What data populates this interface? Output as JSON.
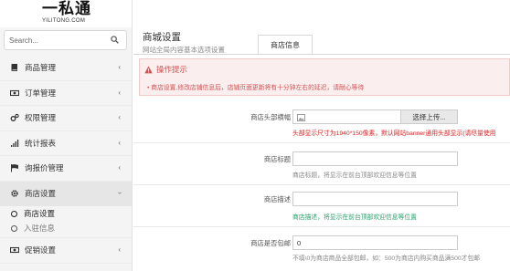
{
  "brand": {
    "name_cn": "一私通",
    "name_en": "YILITONG.COM"
  },
  "search": {
    "placeholder": "Search..."
  },
  "sidebar": {
    "items": [
      {
        "label": "商品管理",
        "icon": "book-icon"
      },
      {
        "label": "订单管理",
        "icon": "money-icon"
      },
      {
        "label": "权限管理",
        "icon": "cogs-icon"
      },
      {
        "label": "统计报表",
        "icon": "bar-chart-icon"
      },
      {
        "label": "询报价管理",
        "icon": "flag-icon"
      },
      {
        "label": "商店设置",
        "icon": "gear-icon"
      }
    ],
    "submenu": [
      {
        "label": "商店设置",
        "active": true
      },
      {
        "label": "入驻信息",
        "active": false
      }
    ],
    "after": {
      "label": "促销设置",
      "icon": "money-icon"
    }
  },
  "header": {
    "title": "商城设置",
    "subtitle": "网站全局内容基本选项设置"
  },
  "tabs": [
    {
      "label": "商店信息"
    }
  ],
  "notice": {
    "title": "操作提示",
    "text": "• 商店设置,修改店铺信息后，店铺页面更新将有十分钟左右的延迟，请耐心等待"
  },
  "form": {
    "banner": {
      "label": "商店头部横幅",
      "button": "选择上传...",
      "hint": "头部显示尺寸为1940*150像素，默认网站banner通用头部显示(请尽量使用"
    },
    "store_title": {
      "label": "商店标题",
      "value": "",
      "hint": "商店标题，将显示在前台顶部欢迎信息等位置"
    },
    "store_desc": {
      "label": "商店描述",
      "value": "",
      "hint": "商店描述，将显示在前台顶部欢迎信息等位置"
    },
    "free_shipping": {
      "label": "商店是否包邮",
      "value": "0",
      "hint": "不填\\0为商店商品全部包邮，如：500为商店内购买商品满500才包邮"
    }
  },
  "colors": {
    "notice_text": "#d95050",
    "error": "#e02020",
    "success": "#2aa06a"
  }
}
